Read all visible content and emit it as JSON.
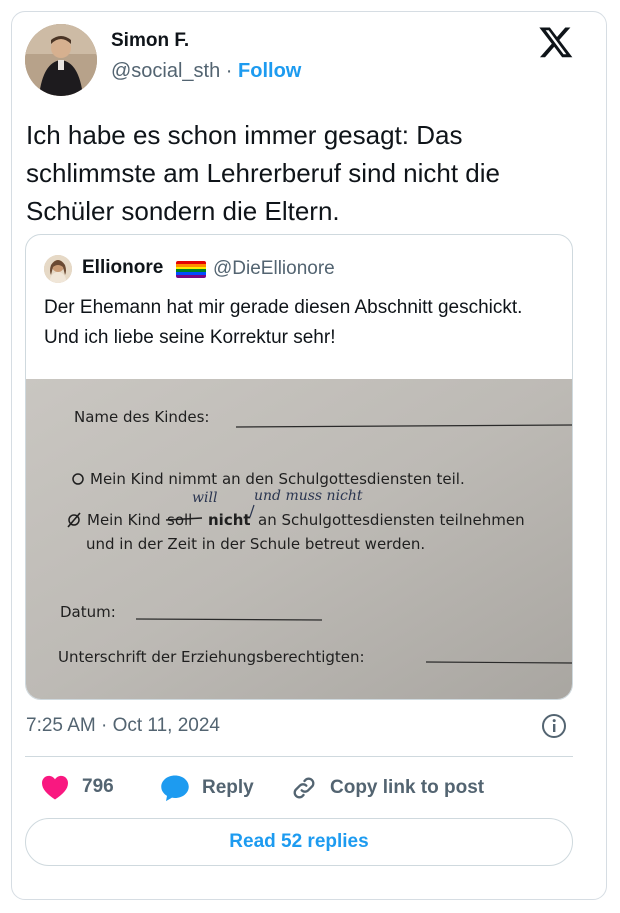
{
  "tweet": {
    "author_name": "Simon F.",
    "author_handle": "@social_sth",
    "separator": " · ",
    "follow_label": "Follow",
    "text": "Ich habe es schon immer gesagt: Das schlimmste am Lehrerberuf sind nicht die Schüler sondern die Eltern.",
    "timestamp": "7:25 AM · Oct 11, 2024"
  },
  "quoted": {
    "author_name": "Ellionore",
    "author_handle": "@DieEllionore",
    "text": "Der Ehemann hat mir gerade diesen Abschnitt geschickt. Und ich liebe seine Korrektur sehr!",
    "photo": {
      "name_label": "Name des Kindes:",
      "option_1": "Mein Kind nimmt an den Schulgottesdiensten teil.",
      "option_2_prefix": "Mein Kind",
      "option_2_struck": "soll",
      "option_2_bold": "nicht",
      "option_2_rest": "an Schulgottesdiensten teilnehmen",
      "option_2_line2": "und in der Zeit in der Schule betreut werden.",
      "handwriting_1": "will",
      "handwriting_2": "und muss nicht",
      "date_label": "Datum:",
      "signature_label": "Unterschrift der Erziehungsberechtigten:"
    }
  },
  "actions": {
    "likes": "796",
    "reply_label": "Reply",
    "copy_label": "Copy link to post",
    "read_replies_label": "Read 52 replies"
  },
  "colors": {
    "accent": "#1d9bf0",
    "like": "#f91880",
    "muted": "#536471",
    "border": "#cfd9de"
  },
  "icons": [
    "x-logo-icon",
    "info-icon",
    "heart-icon",
    "reply-bubble-icon",
    "link-icon"
  ]
}
